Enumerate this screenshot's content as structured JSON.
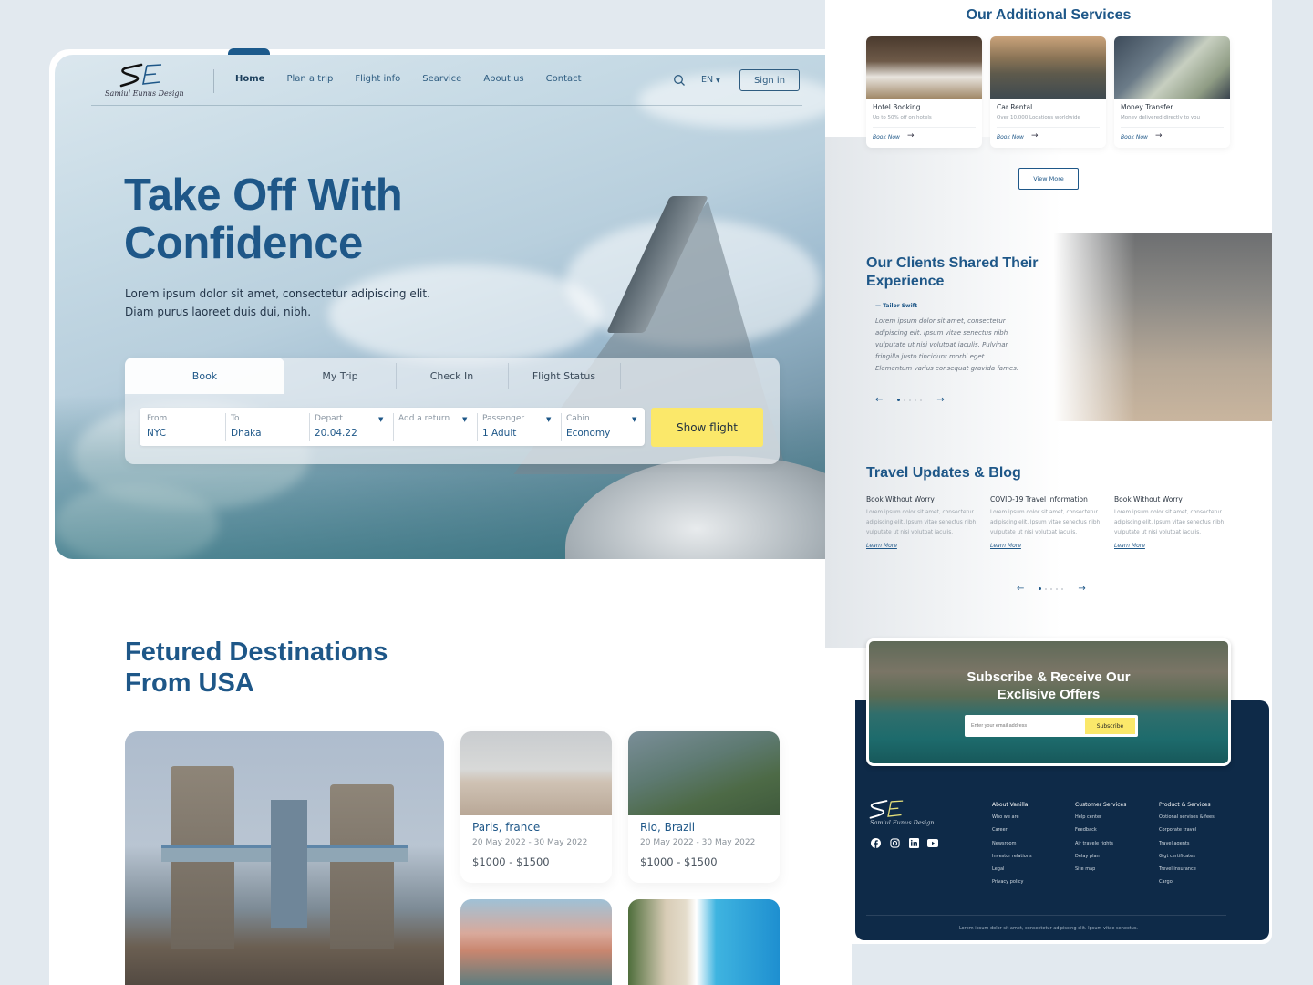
{
  "brand": {
    "logo_mark": "SE",
    "name": "Samiul Eunus Design"
  },
  "nav": {
    "items": [
      {
        "label": "Home",
        "active": true
      },
      {
        "label": "Plan a trip"
      },
      {
        "label": "Flight info"
      },
      {
        "label": "Searvice"
      },
      {
        "label": "About us"
      },
      {
        "label": "Contact"
      }
    ],
    "search_icon": "search-icon",
    "language": "EN",
    "signin_label": "Sign in"
  },
  "hero": {
    "title_line1": "Take Off With",
    "title_line2": "Confidence",
    "subtitle": "Lorem ipsum dolor sit amet, consectetur adipiscing elit. Diam purus laoreet duis dui, nibh."
  },
  "booking": {
    "tabs": [
      {
        "label": "Book",
        "active": true
      },
      {
        "label": "My Trip"
      },
      {
        "label": "Check In"
      },
      {
        "label": "Flight Status"
      }
    ],
    "fields": [
      {
        "label": "From",
        "value": "NYC"
      },
      {
        "label": "To",
        "value": "Dhaka"
      },
      {
        "label": "Depart",
        "value": "20.04.22",
        "dropdown": true
      },
      {
        "label": "Add a return",
        "value": "",
        "dropdown": true
      },
      {
        "label": "Passenger",
        "value": "1 Adult",
        "dropdown": true
      },
      {
        "label": "Cabin",
        "value": "Economy",
        "dropdown": true
      }
    ],
    "submit_label": "Show flight"
  },
  "featured": {
    "title_line1": "Fetured Destinations",
    "title_line2": "From USA",
    "cards": [
      {
        "name": "Paris, france",
        "dates": "20 May 2022 - 30 May 2022",
        "price": "$1000 - $1500"
      },
      {
        "name": "Rio, Brazil",
        "dates": "20 May 2022 - 30 May 2022",
        "price": "$1000 - $1500"
      }
    ]
  },
  "services": {
    "title": "Our Additional Services",
    "cards": [
      {
        "title": "Hotel Booking",
        "desc": "Up to 50% off on hotels",
        "link": "Book Now"
      },
      {
        "title": "Car Rental",
        "desc": "Over 10.000 Locations worldwide",
        "link": "Book Now"
      },
      {
        "title": "Money Transfer",
        "desc": "Money delivered directly to you",
        "link": "Book Now"
      }
    ],
    "view_more": "View More"
  },
  "clients": {
    "title_line1": "Our Clients Shared Their",
    "title_line2": "Experience",
    "author": "— Tailor Swift",
    "quote": "Lorem ipsum dolor sit amet, consectetur adipiscing elit. Ipsum vitae senectus nibh vulputate ut nisi volutpat iaculis. Pulvinar fringilla justo tincidunt morbi eget. Elementum varius consequat gravida fames.",
    "prev": "←",
    "next": "→"
  },
  "blog": {
    "title": "Travel Updates & Blog",
    "posts": [
      {
        "title": "Book Without Worry",
        "body": "Lorem ipsum dolor sit amet, consectetur adipiscing elit. Ipsum vitae senectus nibh vulputate ut nisi volutpat iaculis.",
        "link": "Learn More"
      },
      {
        "title": "COVID-19 Travel Information",
        "body": "Lorem ipsum dolor sit amet, consectetur adipiscing elit. Ipsum vitae senectus nibh vulputate ut nisi volutpat iaculis.",
        "link": "Learn More"
      },
      {
        "title": "Book Without Worry",
        "body": "Lorem ipsum dolor sit amet, consectetur adipiscing elit. Ipsum vitae senectus nibh vulputate ut nisi volutpat iaculis.",
        "link": "Learn More"
      }
    ],
    "prev": "←",
    "next": "→"
  },
  "subscribe": {
    "title_line1": "Subscribe & Receive Our",
    "title_line2": "Exclisive Offers",
    "placeholder": "Enter your email address",
    "button": "Subscribe"
  },
  "footer": {
    "socials": [
      "facebook-icon",
      "instagram-icon",
      "linkedin-icon",
      "youtube-icon"
    ],
    "columns": [
      {
        "heading": "About Vanilla",
        "items": [
          "Who we are",
          "Career",
          "Newsroom",
          "Investor relations",
          "Legal",
          "Privacy policy"
        ]
      },
      {
        "heading": "Customer Services",
        "items": [
          "Help center",
          "Feedback",
          "Air travele rights",
          "Delay plan",
          "Site map"
        ]
      },
      {
        "heading": "Product & Services",
        "items": [
          "Optional servises & fees",
          "Corporate travel",
          "Travel agents",
          "Gigt certificates",
          "Trevel insurance",
          "Cargo"
        ]
      }
    ],
    "copyright": "Lorem ipsum dolor sit amet, consectetur adipiscing elit. Ipsum vitae senectus."
  },
  "colors": {
    "primary": "#1e5788",
    "accent_yellow": "#fbe86a",
    "footer_bg": "#0e2a48",
    "page_bg": "#e2e9ef"
  }
}
